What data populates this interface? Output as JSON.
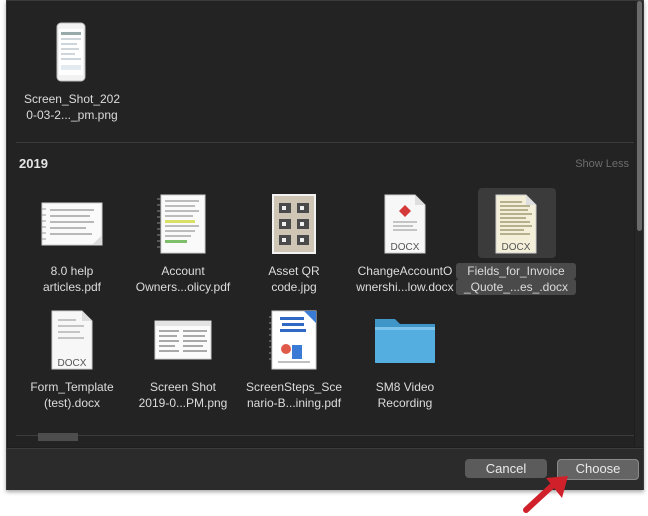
{
  "top_item": {
    "line1": "Screen_Shot_202",
    "line2": "0-03-2..._pm.png"
  },
  "section": {
    "year": "2019",
    "show_less": "Show Less"
  },
  "items": [
    {
      "line1": "8.0 help",
      "line2": "articles.pdf",
      "icon": "pdf-document-icon"
    },
    {
      "line1": "Account",
      "line2": "Owners...olicy.pdf",
      "icon": "pdf-document-icon"
    },
    {
      "line1": "Asset QR",
      "line2": "code.jpg",
      "icon": "qr-image-icon"
    },
    {
      "line1": "ChangeAccountO",
      "line2": "wnershi...low.docx",
      "icon": "docx-document-icon",
      "badge": "DOCX"
    },
    {
      "line1": "Fields_for_Invoice",
      "line2": "_Quote_...es_.docx",
      "icon": "docx-document-icon",
      "badge": "DOCX",
      "selected": true
    },
    {
      "line1": "Form_Template",
      "line2": "(test).docx",
      "icon": "docx-document-icon",
      "badge": "DOCX"
    },
    {
      "line1": "Screen Shot",
      "line2": "2019-0...PM.png",
      "icon": "screenshot-image-icon"
    },
    {
      "line1": "ScreenSteps_Sce",
      "line2": "nario-B...ining.pdf",
      "icon": "pdf-document-icon"
    },
    {
      "line1": "SM8 Video",
      "line2": "Recording",
      "icon": "folder-icon"
    }
  ],
  "buttons": {
    "cancel": "Cancel",
    "choose": "Choose"
  },
  "colors": {
    "accent_arrow": "#d0202a",
    "folder": "#4fa8d8",
    "background": "#232323"
  }
}
